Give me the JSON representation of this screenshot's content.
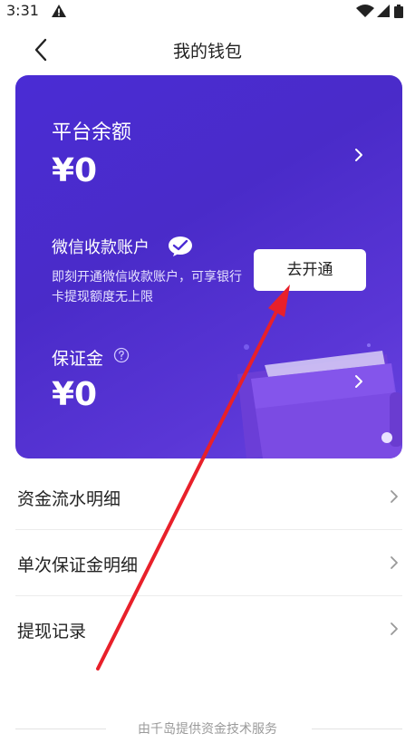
{
  "status_bar": {
    "time": "3:31"
  },
  "nav": {
    "title": "我的钱包"
  },
  "card": {
    "balance_label": "平台余额",
    "balance_value": "¥0",
    "wechat_title": "微信收款账户",
    "wechat_desc": "即刻开通微信收款账户，可享银行卡提现额度无上限",
    "open_button": "去开通",
    "deposit_label": "保证金",
    "deposit_value": "¥0"
  },
  "menu": {
    "items": [
      {
        "label": "资金流水明细"
      },
      {
        "label": "单次保证金明细"
      },
      {
        "label": "提现记录"
      }
    ]
  },
  "footer": {
    "text": "由千岛提供资金技术服务"
  },
  "colors": {
    "card": "#4a2cd4",
    "arrow": "#e8202a"
  }
}
